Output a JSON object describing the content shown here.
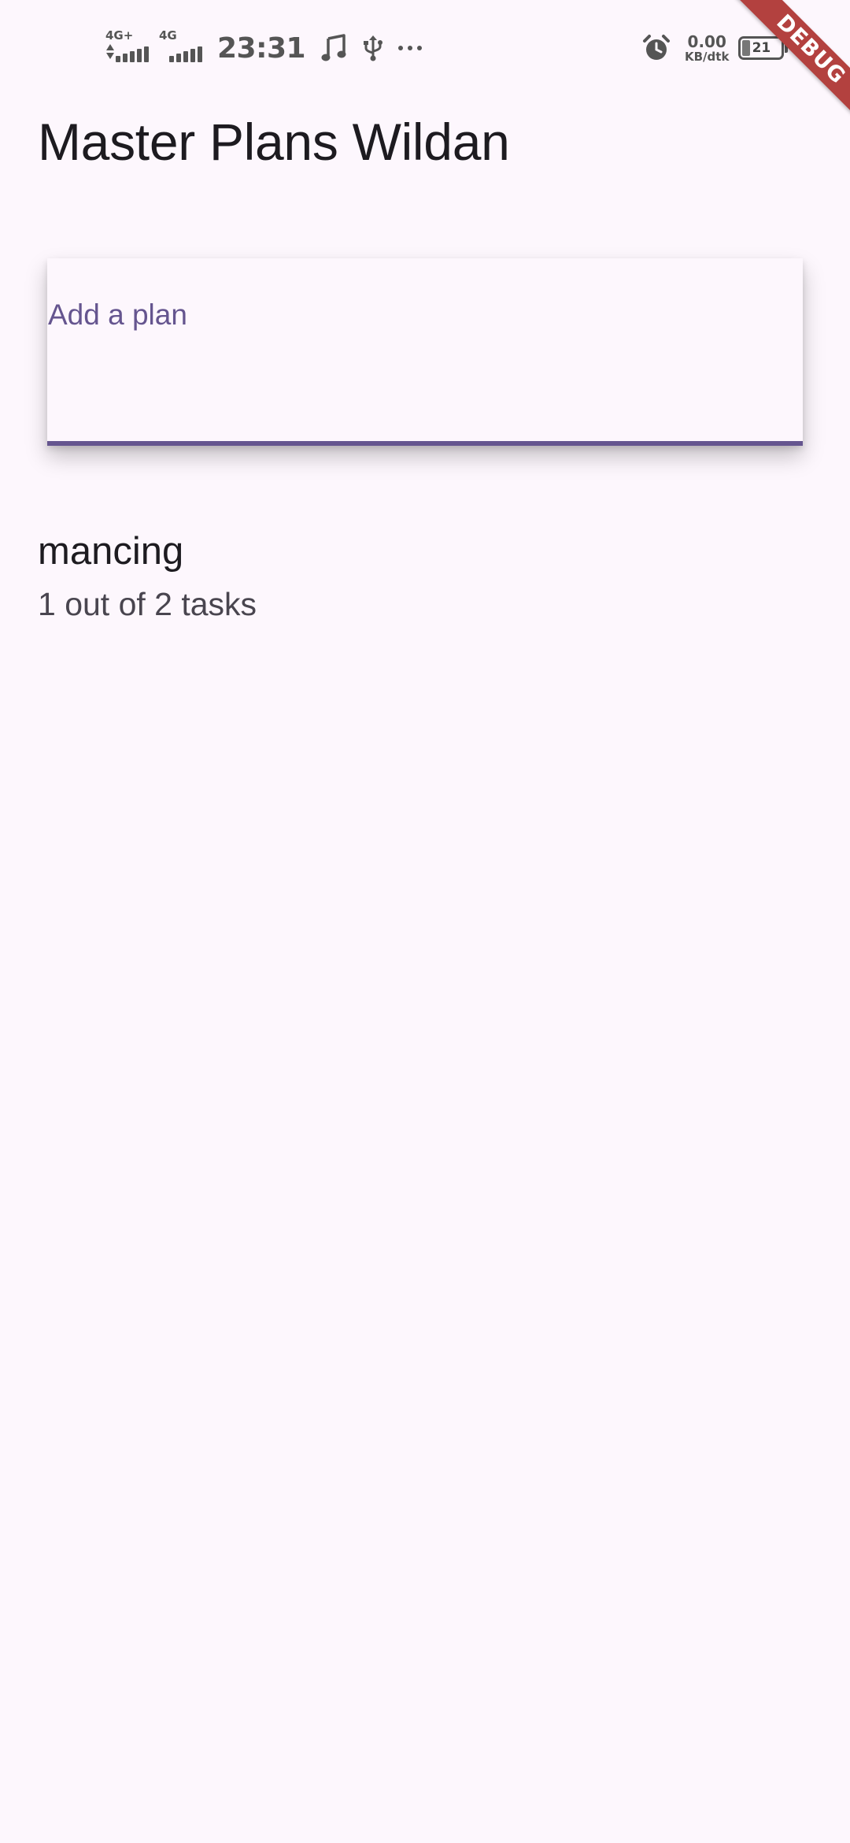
{
  "status_bar": {
    "network_1": "4G+",
    "network_2": "4G",
    "time": "23:31",
    "speed_value": "0.00",
    "speed_unit": "KB/dtk",
    "battery_level": "21"
  },
  "debug_banner": "DEBUG",
  "app_bar": {
    "title": "Master Plans Wildan"
  },
  "add_plan": {
    "label": "Add a plan",
    "value": ""
  },
  "plans": [
    {
      "title": "mancing",
      "subtitle": "1 out of 2 tasks"
    }
  ],
  "colors": {
    "background": "#fdf7fd",
    "accent": "#65558f",
    "debug_banner": "#b3413f"
  }
}
